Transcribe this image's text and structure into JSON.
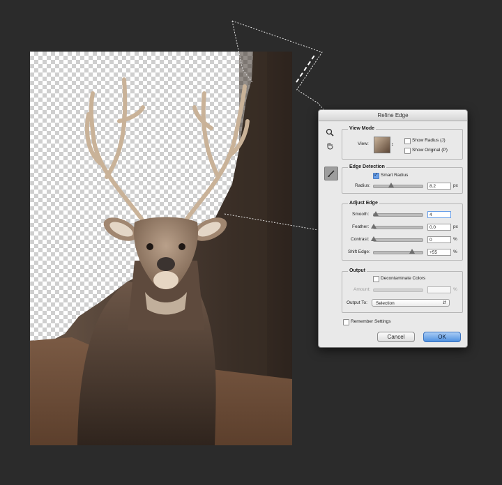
{
  "dialog": {
    "title": "Refine Edge",
    "view_mode": {
      "title": "View Mode",
      "view_label": "View:",
      "show_radius_label": "Show Radius (J)",
      "show_original_label": "Show Original (P)",
      "show_radius_checked": false,
      "show_original_checked": false
    },
    "edge_detection": {
      "title": "Edge Detection",
      "smart_radius_label": "Smart Radius",
      "smart_radius_checked": true,
      "radius_label": "Radius:",
      "radius_value": "8.2",
      "radius_unit": "px",
      "radius_level": 0.35
    },
    "adjust_edge": {
      "title": "Adjust Edge",
      "smooth_label": "Smooth:",
      "smooth_value": "4",
      "smooth_level": 0.04,
      "feather_label": "Feather:",
      "feather_value": "0.0",
      "feather_unit": "px",
      "feather_level": 0.0,
      "contrast_label": "Contrast:",
      "contrast_value": "0",
      "contrast_unit": "%",
      "contrast_level": 0.0,
      "shift_label": "Shift Edge:",
      "shift_value": "+55",
      "shift_unit": "%",
      "shift_level": 0.78
    },
    "output": {
      "title": "Output",
      "decontaminate_label": "Decontaminate Colors",
      "decontaminate_checked": false,
      "amount_label": "Amount:",
      "amount_value": "",
      "amount_unit": "%",
      "output_to_label": "Output To:",
      "output_to_value": "Selection"
    },
    "remember_label": "Remember Settings",
    "remember_checked": false,
    "cancel_label": "Cancel",
    "ok_label": "OK"
  },
  "icons": {
    "zoom": "zoom-icon",
    "hand": "hand-icon",
    "refine_brush": "refine-radius-brush-icon"
  },
  "colors": {
    "background": "#2b2b2b",
    "dialog_bg": "#e9e9e9",
    "ok_accent": "#4f91e0"
  }
}
